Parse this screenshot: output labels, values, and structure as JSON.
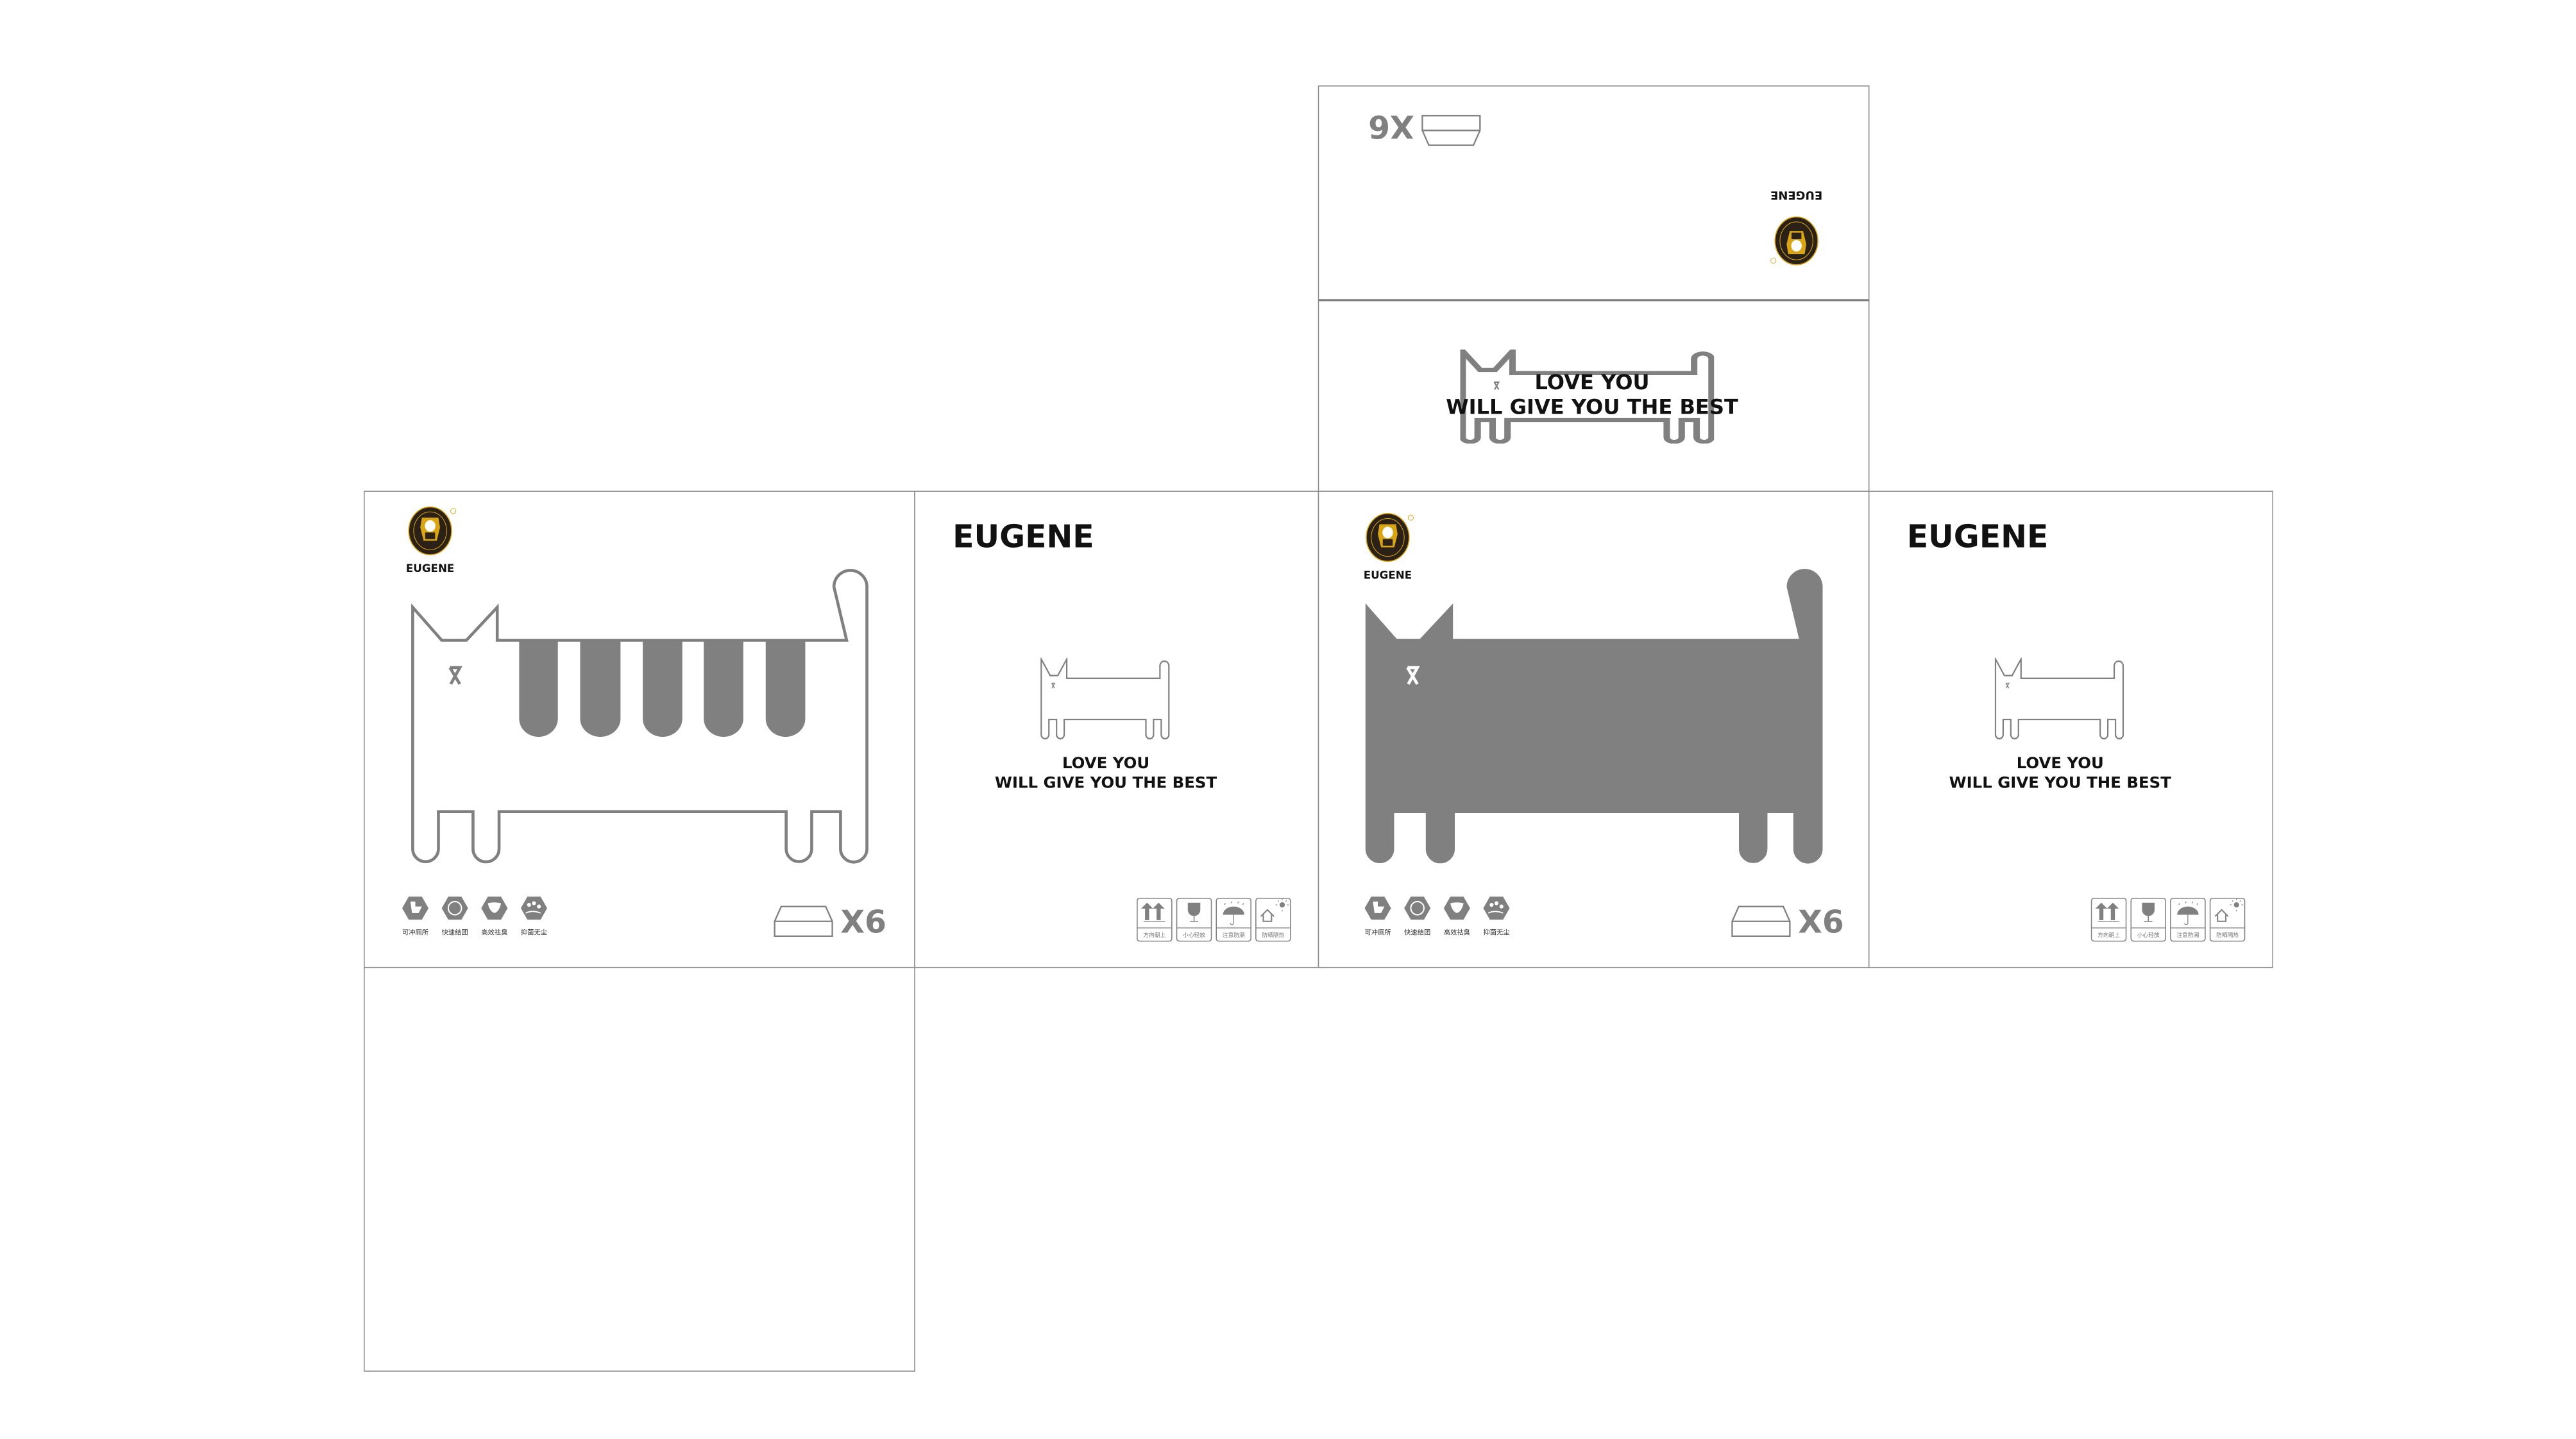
{
  "brand": "EUGENE",
  "logo_text": "EUGENE",
  "slogan": {
    "line1": "LOVE YOU",
    "line2": "WILL GIVE YOU THE BEST"
  },
  "quantity": "X6",
  "features": [
    {
      "icon": "toilet-icon",
      "label": "可冲厕所"
    },
    {
      "icon": "clump-icon",
      "label": "快速结团"
    },
    {
      "icon": "leaf-icon",
      "label": "高效祛臭"
    },
    {
      "icon": "bubbles-icon",
      "label": "抑菌无尘"
    }
  ],
  "warnings": [
    {
      "icon": "this-way-up-icon",
      "label": "方向朝上"
    },
    {
      "icon": "fragile-glass-icon",
      "label": "小心轻放"
    },
    {
      "icon": "umbrella-rain-icon",
      "label": "注意防潮"
    },
    {
      "icon": "sun-house-icon",
      "label": "防晒隔热"
    }
  ],
  "colors": {
    "line": "#808080",
    "logo_dark": "#2b2116",
    "logo_gold": "#d9a514",
    "text": "#111111"
  }
}
